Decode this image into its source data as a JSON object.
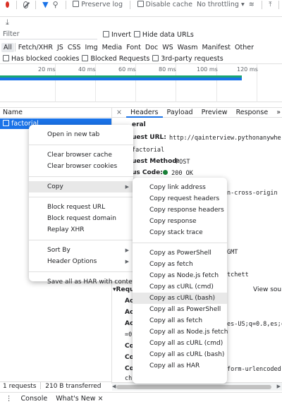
{
  "toolbar": {
    "preserve_log": "Preserve log",
    "disable_cache": "Disable cache",
    "throttling": "No throttling",
    "throttle_arrow": "▾"
  },
  "filter": {
    "placeholder": "Filter",
    "invert": "Invert",
    "hide_data_urls": "Hide data URLs"
  },
  "types": [
    "All",
    "Fetch/XHR",
    "JS",
    "CSS",
    "Img",
    "Media",
    "Font",
    "Doc",
    "WS",
    "Wasm",
    "Manifest",
    "Other"
  ],
  "blocked": {
    "has_blocked_cookies": "Has blocked cookies",
    "blocked_requests": "Blocked Requests",
    "third_party": "3rd-party requests"
  },
  "timeline": {
    "ticks": [
      "20 ms",
      "40 ms",
      "60 ms",
      "80 ms",
      "100 ms",
      "120 ms"
    ]
  },
  "requests": {
    "header": "Name",
    "row_name": "factorial"
  },
  "detail_tabs": {
    "close": "×",
    "tabs": [
      "Headers",
      "Payload",
      "Preview",
      "Response"
    ],
    "more": "»"
  },
  "details": {
    "general_header": "eral",
    "request_url_label": "uest URL:",
    "request_url_value": "http://qainterview.pythonanywhere.c",
    "path": "factorial",
    "method_label": "uest Method:",
    "method_value": "POST",
    "status_label": "us Code:",
    "status_value": "200 OK",
    "referrer_value": "n-cross-origin",
    "date_value": "GMT",
    "server_value": "tchett",
    "request_headers_label": "Requ",
    "view_source": "View sou",
    "ac1": "Ac",
    "ac2": "Ac",
    "ac3": "Ac",
    "accept_language": "es-US;q=0.8,es;c",
    "q_value": "=0.",
    "co1": "Co",
    "co2": "Co",
    "co3": "Co",
    "content_type": "form-urlencoded;",
    "ch": "ch"
  },
  "status": {
    "requests": "1 requests",
    "transferred": "210 B transferred"
  },
  "drawer": {
    "menu": "⋮",
    "console": "Console",
    "whats_new": "What's New",
    "whats_new_close": "×"
  },
  "context_menu": {
    "items": [
      {
        "label": "Open in new tab"
      },
      {
        "label": "Clear browser cache"
      },
      {
        "label": "Clear browser cookies"
      },
      {
        "label": "Copy",
        "submenu": true
      },
      {
        "label": "Block request URL"
      },
      {
        "label": "Block request domain"
      },
      {
        "label": "Replay XHR"
      },
      {
        "label": "Sort By",
        "submenu": true
      },
      {
        "label": "Header Options",
        "submenu": true
      },
      {
        "label": "Save all as HAR with content"
      }
    ]
  },
  "copy_menu": {
    "items": [
      "Copy link address",
      "Copy request headers",
      "Copy response headers",
      "Copy response",
      "Copy stack trace",
      "Copy as PowerShell",
      "Copy as fetch",
      "Copy as Node.js fetch",
      "Copy as cURL (cmd)",
      "Copy as cURL (bash)",
      "Copy all as PowerShell",
      "Copy all as fetch",
      "Copy all as Node.js fetch",
      "Copy all as cURL (cmd)",
      "Copy all as cURL (bash)",
      "Copy all as HAR"
    ],
    "highlighted_index": 9
  },
  "colors": {
    "accent": "#1a73e8",
    "record": "#d93025",
    "status_ok": "#188038",
    "timeline_green": "#18a574"
  },
  "icons": {
    "record": "record-icon",
    "clear": "clear-icon",
    "filter": "filter-icon",
    "search": "search-icon",
    "wifi": "network-conditions-icon",
    "import": "import-har-icon",
    "export": "export-har-icon",
    "submenu": "chevron-right-icon"
  }
}
